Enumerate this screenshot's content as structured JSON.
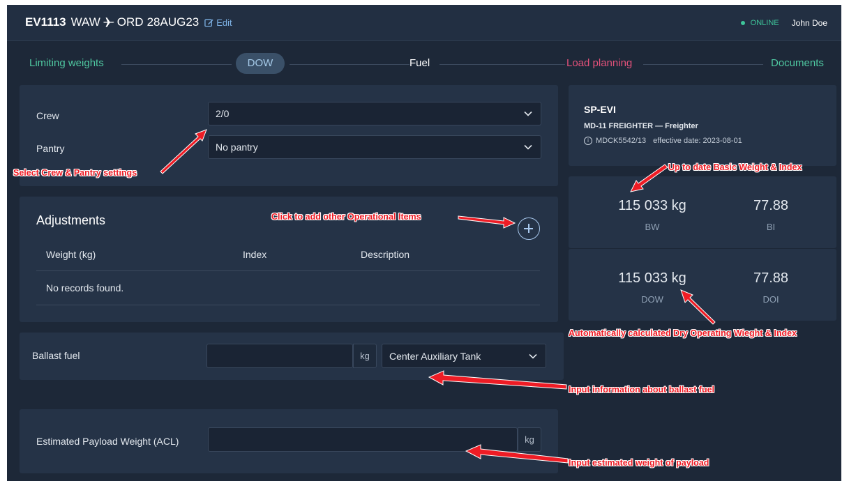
{
  "header": {
    "flight_number": "EV1113",
    "origin": "WAW",
    "destination": "ORD",
    "date": "28AUG23",
    "edit_label": "Edit",
    "status": "ONLINE",
    "user": "John Doe"
  },
  "steps": {
    "limiting_weights": "Limiting weights",
    "dow": "DOW",
    "fuel": "Fuel",
    "load_planning": "Load planning",
    "documents": "Documents"
  },
  "crew_panel": {
    "crew_label": "Crew",
    "crew_value": "2/0",
    "pantry_label": "Pantry",
    "pantry_value": "No pantry"
  },
  "adjustments": {
    "title": "Adjustments",
    "columns": [
      "Weight (kg)",
      "Index",
      "Description"
    ],
    "empty_text": "No records found."
  },
  "ballast": {
    "label": "Ballast fuel",
    "value": "",
    "unit": "kg",
    "tank": "Center Auxiliary Tank"
  },
  "payload": {
    "label": "Estimated Payload Weight (ACL)",
    "value": "",
    "unit": "kg"
  },
  "aircraft": {
    "registration": "SP-EVI",
    "type": "MD-11 FREIGHTER — Freighter",
    "doc_id": "MDCK5542/13",
    "effective": "effective date: 2023-08-01"
  },
  "basic": {
    "bw_value": "115 033 kg",
    "bw_label": "BW",
    "bi_value": "77.88",
    "bi_label": "BI"
  },
  "dry": {
    "dow_value": "115 033 kg",
    "dow_label": "DOW",
    "doi_value": "77.88",
    "doi_label": "DOI"
  },
  "annotations": {
    "crew_pantry": "Select Crew & Pantry settings",
    "add_items": "Click to add other Operational Items",
    "basic_weight": "Up to date Basic Weight & Index",
    "dry_operating": "Automatically calculated Dry Operating Wieght & Index",
    "ballast": "Input information about ballast fuel",
    "payload": "Input estimated weight of payload"
  },
  "colors": {
    "background": "#1d2838",
    "panel": "#253347",
    "done_step": "#4fc8a1",
    "warn_step": "#e2517a",
    "annotation": "#ee1c25"
  }
}
